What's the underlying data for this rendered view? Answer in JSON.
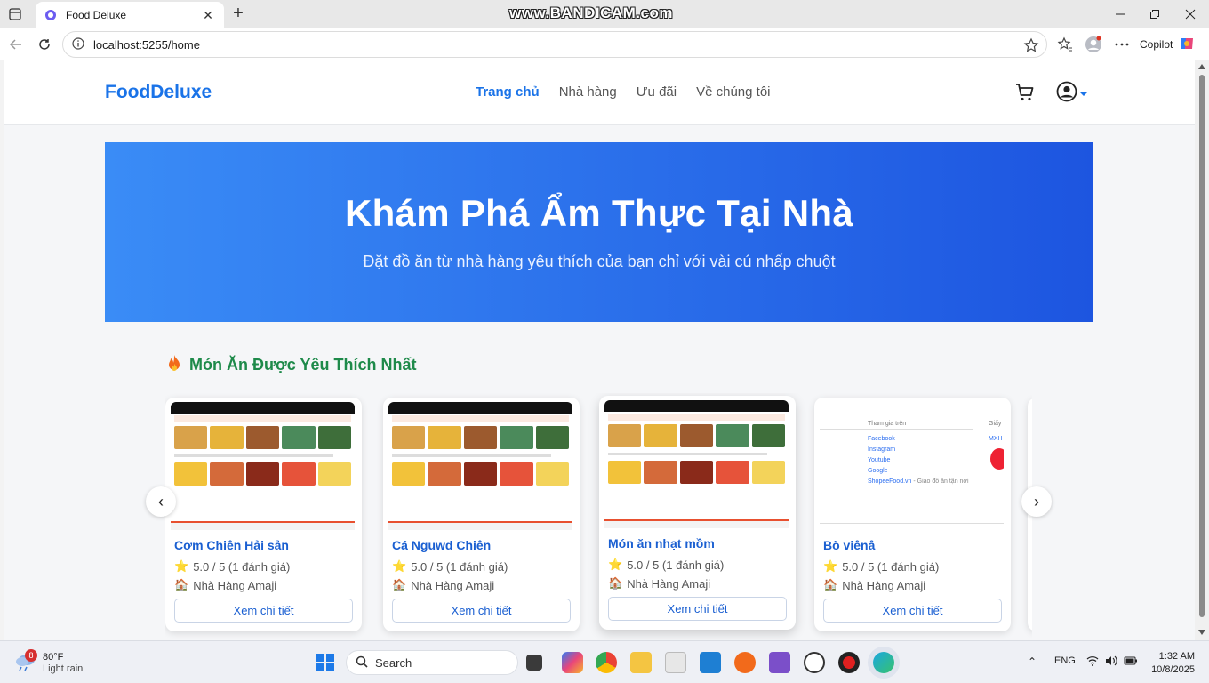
{
  "browser": {
    "tab_title": "Food Deluxe",
    "url": "localhost:5255/home",
    "copilot_label": "Copilot",
    "watermark": "www.BANDICAM.com"
  },
  "site": {
    "brand": "FoodDeluxe",
    "nav": [
      "Trang chủ",
      "Nhà hàng",
      "Ưu đãi",
      "Về chúng tôi"
    ],
    "active_nav": "Trang chủ",
    "accent_color": "#1a73e8"
  },
  "hero": {
    "title": "Khám Phá Ẩm Thực Tại Nhà",
    "subtitle": "Đặt đồ ăn từ nhà hàng yêu thích của bạn chỉ với vài cú nhấp chuột"
  },
  "section": {
    "icon": "fire-icon",
    "title": "Món Ăn Được Yêu Thích Nhất"
  },
  "dishes": [
    {
      "name": "Cơm Chiên Hải sản",
      "rating": "5.0 / 5 (1 đánh giá)",
      "restaurant": "Nhà Hàng Amaji",
      "button": "Xem chi tiết"
    },
    {
      "name": "Cá Nguwd Chiên",
      "rating": "5.0 / 5 (1 đánh giá)",
      "restaurant": "Nhà Hàng Amaji",
      "button": "Xem chi tiết"
    },
    {
      "name": "Món ăn nhạt mồm",
      "rating": "5.0 / 5 (1 đánh giá)",
      "restaurant": "Nhà Hàng Amaji",
      "button": "Xem chi tiết"
    },
    {
      "name": "Bò viênâ",
      "rating": "5.0 / 5 (1 đánh giá)",
      "restaurant": "Nhà Hàng Amaji",
      "button": "Xem chi tiết"
    }
  ],
  "fourth_thumb": {
    "heading": "Tham gia trên",
    "heading2": "Giấy",
    "links": [
      "Facebook",
      "Instagram",
      "Youtube",
      "Google",
      "ShopeeFood.vn"
    ],
    "tagline": "- Giao đồ ăn tận nơi",
    "side": "MXH"
  },
  "taskbar": {
    "weather_temp": "80°F",
    "weather_cond": "Light rain",
    "weather_badge": "8",
    "search_label": "Search",
    "lang": "ENG",
    "time": "1:32 AM",
    "date": "10/8/2025"
  }
}
